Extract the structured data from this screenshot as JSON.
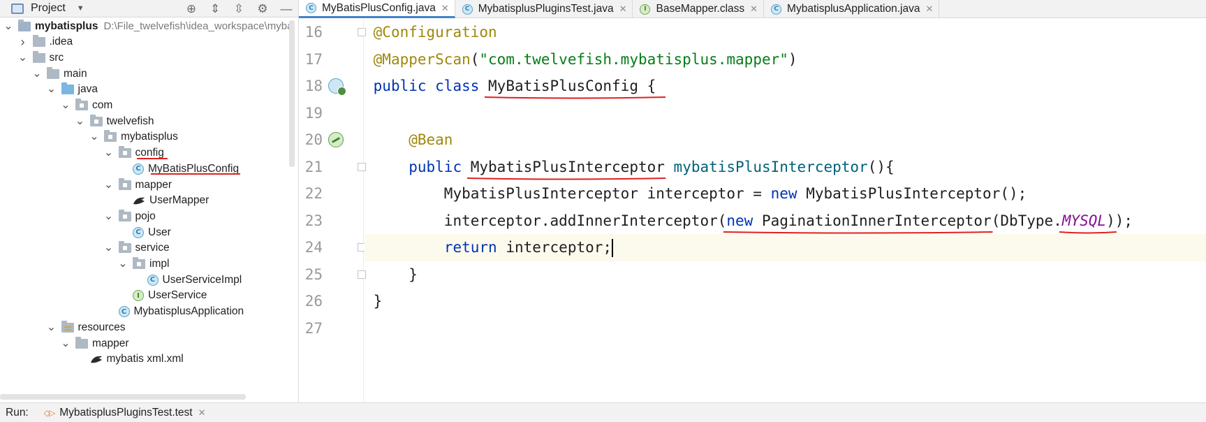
{
  "project_panel": {
    "title": "Project",
    "tree": [
      {
        "label": "mybatisplus",
        "path": "D:\\File_twelvefish\\idea_workspace\\myba",
        "type": "module",
        "depth": 0,
        "expanded": true
      },
      {
        "label": ".idea",
        "type": "folder",
        "depth": 1,
        "expanded": false
      },
      {
        "label": "src",
        "type": "folder",
        "depth": 1,
        "expanded": true
      },
      {
        "label": "main",
        "type": "folder",
        "depth": 2,
        "expanded": true
      },
      {
        "label": "java",
        "type": "source-folder",
        "depth": 3,
        "expanded": true
      },
      {
        "label": "com",
        "type": "package",
        "depth": 4,
        "expanded": true
      },
      {
        "label": "twelvefish",
        "type": "package",
        "depth": 5,
        "expanded": true
      },
      {
        "label": "mybatisplus",
        "type": "package",
        "depth": 6,
        "expanded": true
      },
      {
        "label": "config",
        "type": "package",
        "depth": 7,
        "expanded": true
      },
      {
        "label": "MyBatisPlusConfig",
        "type": "class",
        "depth": 8
      },
      {
        "label": "mapper",
        "type": "package",
        "depth": 7,
        "expanded": true
      },
      {
        "label": "UserMapper",
        "type": "mapper",
        "depth": 8
      },
      {
        "label": "pojo",
        "type": "package",
        "depth": 7,
        "expanded": true
      },
      {
        "label": "User",
        "type": "class",
        "depth": 8
      },
      {
        "label": "service",
        "type": "package",
        "depth": 7,
        "expanded": true
      },
      {
        "label": "impl",
        "type": "package",
        "depth": 8,
        "expanded": true
      },
      {
        "label": "UserServiceImpl",
        "type": "class",
        "depth": 9
      },
      {
        "label": "UserService",
        "type": "interface",
        "depth": 8
      },
      {
        "label": "MybatisplusApplication",
        "type": "app-class",
        "depth": 7
      },
      {
        "label": "resources",
        "type": "resources-folder",
        "depth": 3,
        "expanded": true
      },
      {
        "label": "mapper",
        "type": "folder",
        "depth": 4,
        "expanded": true
      },
      {
        "label": "mybatis xml.xml",
        "type": "mapper",
        "depth": 5
      }
    ]
  },
  "tabs": [
    {
      "label": "MyBatisPlusConfig.java",
      "icon": "class-icon",
      "active": true
    },
    {
      "label": "MybatisplusPluginsTest.java",
      "icon": "test-class-icon",
      "active": false
    },
    {
      "label": "BaseMapper.class",
      "icon": "interface-icon",
      "active": false
    },
    {
      "label": "MybatisplusApplication.java",
      "icon": "app-class-icon",
      "active": false
    }
  ],
  "editor": {
    "current_line": 24,
    "lines": [
      {
        "n": "16",
        "tokens": [
          [
            "ann",
            "@Configuration"
          ]
        ]
      },
      {
        "n": "17",
        "tokens": [
          [
            "ann",
            "@MapperScan"
          ],
          [
            "plain",
            "("
          ],
          [
            "str",
            "\"com.twelvefish.mybatisplus.mapper\""
          ],
          [
            "plain",
            ")"
          ]
        ]
      },
      {
        "n": "18",
        "tokens": [
          [
            "kw",
            "public class "
          ],
          [
            "plain",
            "MyBatisPlusConfig {"
          ]
        ]
      },
      {
        "n": "19",
        "tokens": []
      },
      {
        "n": "20",
        "tokens": [
          [
            "plain",
            "    "
          ],
          [
            "ann",
            "@Bean"
          ]
        ]
      },
      {
        "n": "21",
        "tokens": [
          [
            "plain",
            "    "
          ],
          [
            "kw",
            "public "
          ],
          [
            "plain",
            "MybatisPlusInterceptor "
          ],
          [
            "fn",
            "mybatisPlusInterceptor"
          ],
          [
            "plain",
            "(){"
          ]
        ]
      },
      {
        "n": "22",
        "tokens": [
          [
            "plain",
            "        MybatisPlusInterceptor interceptor = "
          ],
          [
            "kw",
            "new "
          ],
          [
            "plain",
            "MybatisPlusInterceptor();"
          ]
        ]
      },
      {
        "n": "23",
        "tokens": [
          [
            "plain",
            "        interceptor.addInnerInterceptor("
          ],
          [
            "kw",
            "new "
          ],
          [
            "plain",
            "PaginationInnerInterceptor(DbType."
          ],
          [
            "const",
            "MYSQL"
          ],
          [
            "plain",
            "));"
          ]
        ]
      },
      {
        "n": "24",
        "tokens": [
          [
            "plain",
            "        "
          ],
          [
            "kw",
            "return "
          ],
          [
            "plain",
            "interceptor;"
          ]
        ]
      },
      {
        "n": "25",
        "tokens": [
          [
            "plain",
            "    }"
          ]
        ]
      },
      {
        "n": "26",
        "tokens": [
          [
            "plain",
            "}"
          ]
        ]
      },
      {
        "n": "27",
        "tokens": []
      }
    ]
  },
  "run_bar": {
    "label": "Run:",
    "config_name": "MybatisplusPluginsTest.test"
  },
  "colors": {
    "annotation": "#9e880d",
    "keyword": "#0033b3",
    "string": "#067d17",
    "method": "#00627a",
    "constant": "#871094",
    "markup_underline": "#e02020",
    "active_tab_indicator": "#4083c9"
  }
}
